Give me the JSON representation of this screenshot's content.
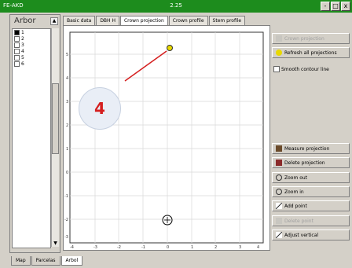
{
  "window": {
    "app_name": "FE-AKD",
    "title": "2.25",
    "controls": [
      "-",
      "□",
      "x"
    ]
  },
  "left_panel": {
    "header_label": "Arbor",
    "items": [
      "1",
      "2",
      "3",
      "4",
      "5",
      "6"
    ]
  },
  "tabs": [
    {
      "label": "Basic data",
      "active": false
    },
    {
      "label": "DBH H",
      "active": false
    },
    {
      "label": "Crown projection",
      "active": true
    },
    {
      "label": "Crown profile",
      "active": false
    },
    {
      "label": "Stem profile",
      "active": false
    }
  ],
  "plot": {
    "y_ticks": [
      "5",
      "4",
      "3",
      "2",
      "1",
      "0",
      "-1",
      "-2",
      "-3",
      "-4"
    ],
    "x_ticks": [
      "-4",
      "-3",
      "-2",
      "-1",
      "0",
      "1",
      "2",
      "3",
      "4"
    ]
  },
  "right_panel": {
    "top_buttons": [
      {
        "label": "Crown projection",
        "disabled": true,
        "icon": "crown-projection-icon"
      },
      {
        "label": "Refresh all projections",
        "disabled": false,
        "icon": "refresh-icon"
      }
    ],
    "checkbox_label": "Smooth contour line",
    "buttons": [
      {
        "label": "Measure projection",
        "disabled": false,
        "icon": "tree-icon"
      },
      {
        "label": "Delete projection",
        "disabled": false,
        "icon": "delete-icon"
      },
      {
        "label": "Zoom out",
        "disabled": false,
        "icon": "zoom-out-icon"
      },
      {
        "label": "Zoom in",
        "disabled": false,
        "icon": "zoom-in-icon"
      },
      {
        "label": "Add point",
        "disabled": false,
        "icon": "add-point-icon"
      },
      {
        "label": "Delete point",
        "disabled": true,
        "icon": "delete-point-icon"
      },
      {
        "label": "Adjust vertical",
        "disabled": false,
        "icon": "adjust-icon"
      }
    ]
  },
  "bottom_tabs": [
    {
      "label": "Map",
      "active": false
    },
    {
      "label": "Parcelas",
      "active": false
    },
    {
      "label": "Arbol",
      "active": true
    }
  ],
  "callout": {
    "number": "4"
  }
}
